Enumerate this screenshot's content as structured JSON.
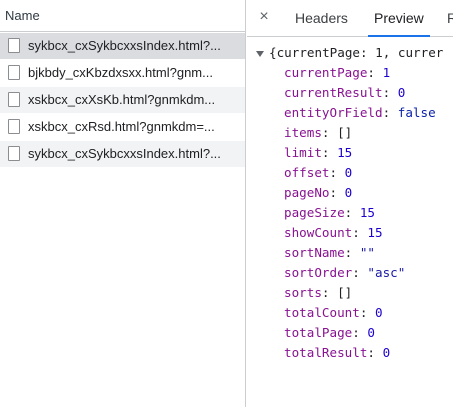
{
  "request_list": {
    "header": "Name",
    "items": [
      {
        "label": "sykbcx_cxSykbcxxsIndex.html?...",
        "selected": true
      },
      {
        "label": "bjkbdy_cxKbzdxsxx.html?gnm..."
      },
      {
        "label": "xskbcx_cxXsKb.html?gnmkdm..."
      },
      {
        "label": "xskbcx_cxRsd.html?gnmkdm=..."
      },
      {
        "label": "sykbcx_cxSykbcxxsIndex.html?..."
      }
    ]
  },
  "detail": {
    "close_glyph": "×",
    "tabs": [
      "Headers",
      "Preview",
      "R"
    ],
    "active_tab": "Preview"
  },
  "preview": {
    "summary": "{currentPage: 1, currer",
    "properties": [
      {
        "key": "currentPage",
        "value": "1",
        "type": "number"
      },
      {
        "key": "currentResult",
        "value": "0",
        "type": "number"
      },
      {
        "key": "entityOrField",
        "value": "false",
        "type": "keyword"
      },
      {
        "key": "items",
        "value": "[]",
        "type": "array"
      },
      {
        "key": "limit",
        "value": "15",
        "type": "number"
      },
      {
        "key": "offset",
        "value": "0",
        "type": "number"
      },
      {
        "key": "pageNo",
        "value": "0",
        "type": "number"
      },
      {
        "key": "pageSize",
        "value": "15",
        "type": "number"
      },
      {
        "key": "showCount",
        "value": "15",
        "type": "number"
      },
      {
        "key": "sortName",
        "value": "\"\"",
        "type": "string"
      },
      {
        "key": "sortOrder",
        "value": "\"asc\"",
        "type": "string"
      },
      {
        "key": "sorts",
        "value": "[]",
        "type": "array"
      },
      {
        "key": "totalCount",
        "value": "0",
        "type": "number"
      },
      {
        "key": "totalPage",
        "value": "0",
        "type": "number"
      },
      {
        "key": "totalResult",
        "value": "0",
        "type": "number"
      }
    ]
  }
}
